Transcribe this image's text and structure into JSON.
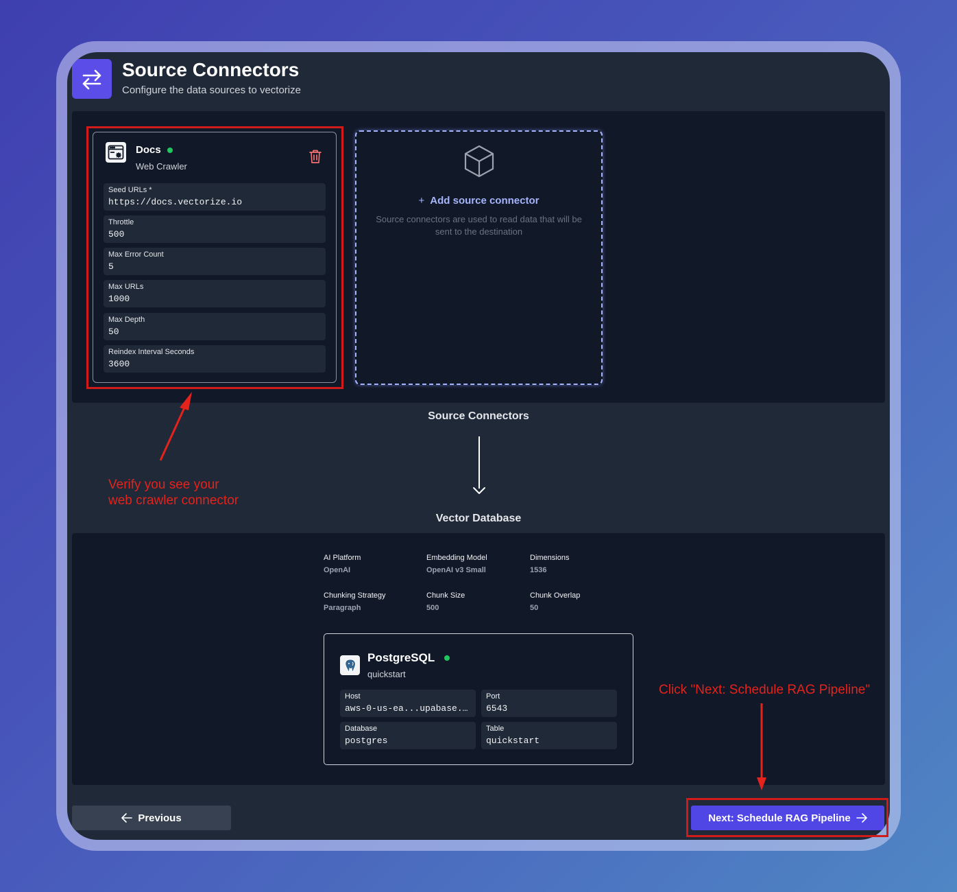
{
  "header": {
    "title": "Source Connectors",
    "subtitle": "Configure the data sources to vectorize"
  },
  "source_card": {
    "name": "Docs",
    "status_color": "#22c55e",
    "type": "Web Crawler",
    "fields": [
      {
        "label": "Seed URLs *",
        "value": "https://docs.vectorize.io"
      },
      {
        "label": "Throttle",
        "value": "500"
      },
      {
        "label": "Max Error Count",
        "value": "5"
      },
      {
        "label": "Max URLs",
        "value": "1000"
      },
      {
        "label": "Max Depth",
        "value": "50"
      },
      {
        "label": "Reindex Interval Seconds",
        "value": "3600"
      }
    ]
  },
  "add_card": {
    "label": "Add source connector",
    "description": "Source connectors are used to read data that will be sent to the destination"
  },
  "flow": {
    "from_label": "Source Connectors",
    "to_label": "Vector Database"
  },
  "vector_config": [
    {
      "label": "AI Platform",
      "value": "OpenAI"
    },
    {
      "label": "Embedding Model",
      "value": "OpenAI v3 Small"
    },
    {
      "label": "Dimensions",
      "value": "1536"
    },
    {
      "label": "Chunking Strategy",
      "value": "Paragraph"
    },
    {
      "label": "Chunk Size",
      "value": "500"
    },
    {
      "label": "Chunk Overlap",
      "value": "50"
    }
  ],
  "db_card": {
    "name": "PostgreSQL",
    "type": "quickstart",
    "fields": [
      {
        "label": "Host",
        "value": "aws-0-us-ea...upabase.…"
      },
      {
        "label": "Port",
        "value": "6543"
      },
      {
        "label": "Database",
        "value": "postgres"
      },
      {
        "label": "Table",
        "value": "quickstart"
      }
    ]
  },
  "buttons": {
    "previous": "Previous",
    "next": "Next: Schedule RAG Pipeline"
  },
  "annotations": {
    "verify_line1": "Verify you see your",
    "verify_line2": "web crawler connector",
    "click_next": "Click \"Next: Schedule RAG Pipeline\""
  },
  "colors": {
    "accent": "#4f46e5",
    "annotation": "#e3231c",
    "status_ok": "#22c55e"
  }
}
